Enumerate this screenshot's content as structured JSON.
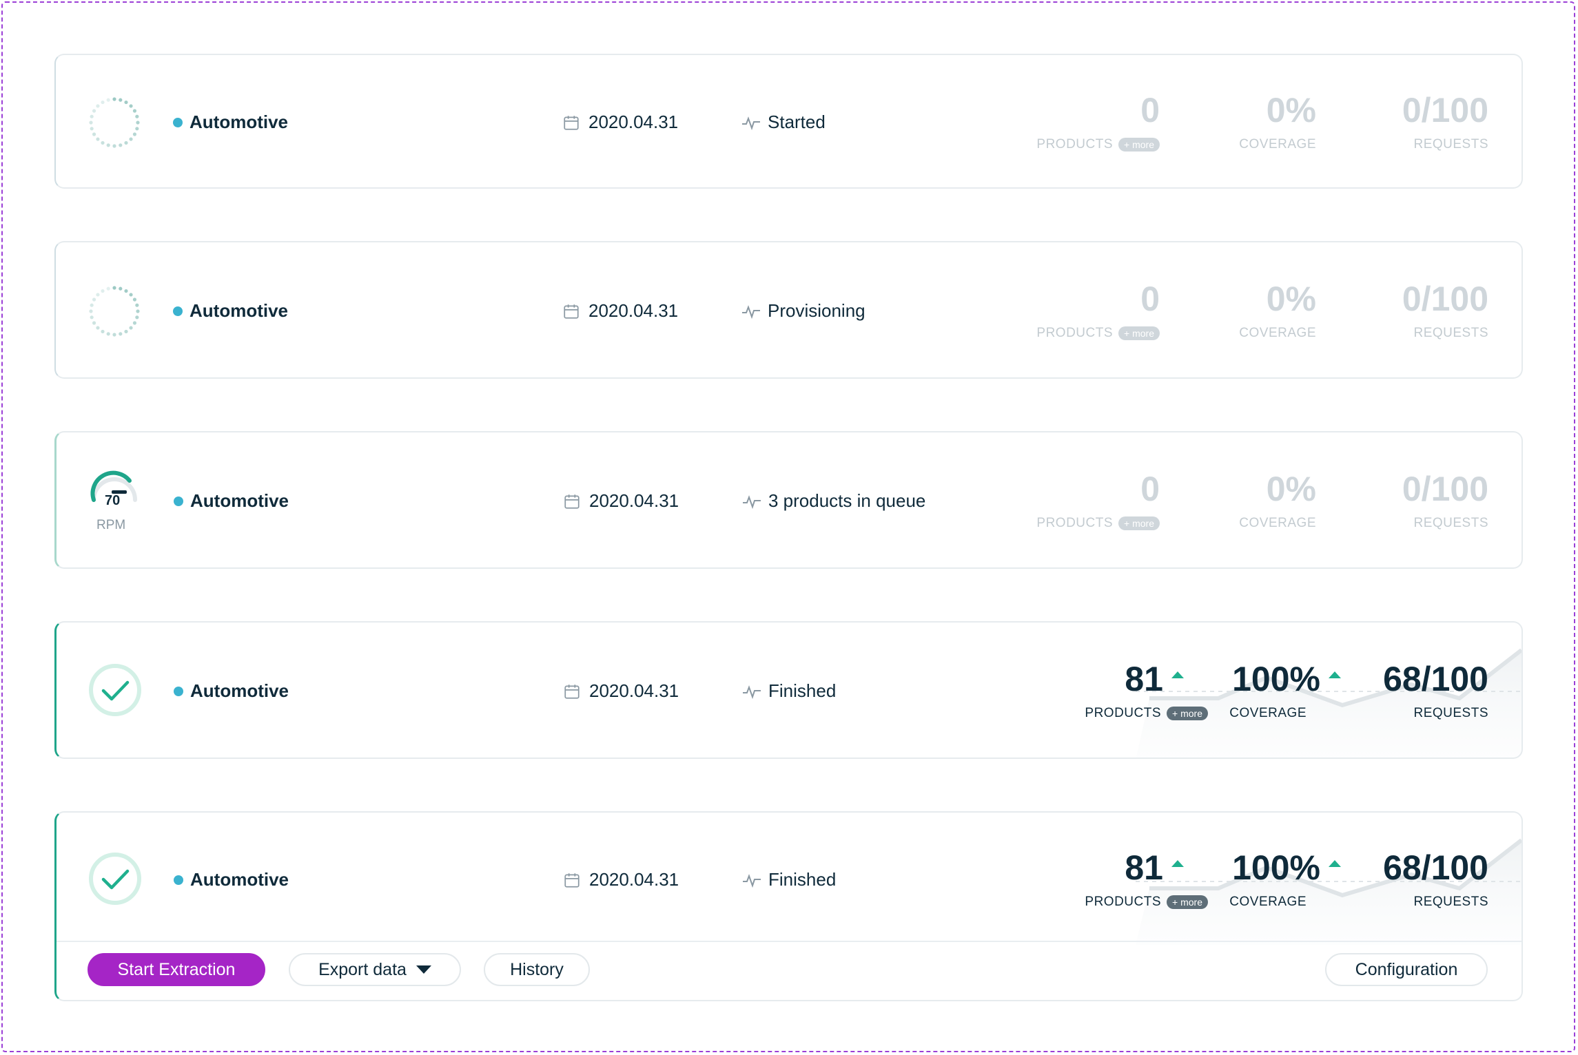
{
  "cards": [
    {
      "category": "Automotive",
      "date": "2020.04.31",
      "status": "Started",
      "products": "0",
      "products_label": "PRODUCTS",
      "more": "+ more",
      "coverage": "0%",
      "coverage_label": "COVERAGE",
      "requests": "0/100",
      "requests_label": "REQUESTS"
    },
    {
      "category": "Automotive",
      "date": "2020.04.31",
      "status": "Provisioning",
      "products": "0",
      "products_label": "PRODUCTS",
      "more": "+ more",
      "coverage": "0%",
      "coverage_label": "COVERAGE",
      "requests": "0/100",
      "requests_label": "REQUESTS"
    },
    {
      "category": "Automotive",
      "date": "2020.04.31",
      "status": "3 products in queue",
      "gauge_value": "70",
      "gauge_unit": "RPM",
      "products": "0",
      "products_label": "PRODUCTS",
      "more": "+ more",
      "coverage": "0%",
      "coverage_label": "COVERAGE",
      "requests": "0/100",
      "requests_label": "REQUESTS"
    },
    {
      "category": "Automotive",
      "date": "2020.04.31",
      "status": "Finished",
      "products": "81",
      "products_label": "PRODUCTS",
      "more": "+ more",
      "coverage": "100%",
      "coverage_label": "COVERAGE",
      "requests": "68/100",
      "requests_label": "REQUESTS"
    },
    {
      "category": "Automotive",
      "date": "2020.04.31",
      "status": "Finished",
      "products": "81",
      "products_label": "PRODUCTS",
      "more": "+ more",
      "coverage": "100%",
      "coverage_label": "COVERAGE",
      "requests": "68/100",
      "requests_label": "REQUESTS"
    }
  ],
  "actions": {
    "start": "Start Extraction",
    "export": "Export data",
    "history": "History",
    "configuration": "Configuration"
  },
  "colors": {
    "accent": "#a525c6",
    "success": "#1fb08e",
    "category_dot": "#3ab2cf",
    "muted_text": "#cfd6db"
  },
  "icons": {
    "calendar": "calendar-icon",
    "activity": "activity-icon",
    "spinner": "loading-spinner-icon",
    "check": "check-circle-icon",
    "gauge": "gauge-icon",
    "trend_up": "trend-up-triangle-icon",
    "caret": "caret-down-icon"
  }
}
